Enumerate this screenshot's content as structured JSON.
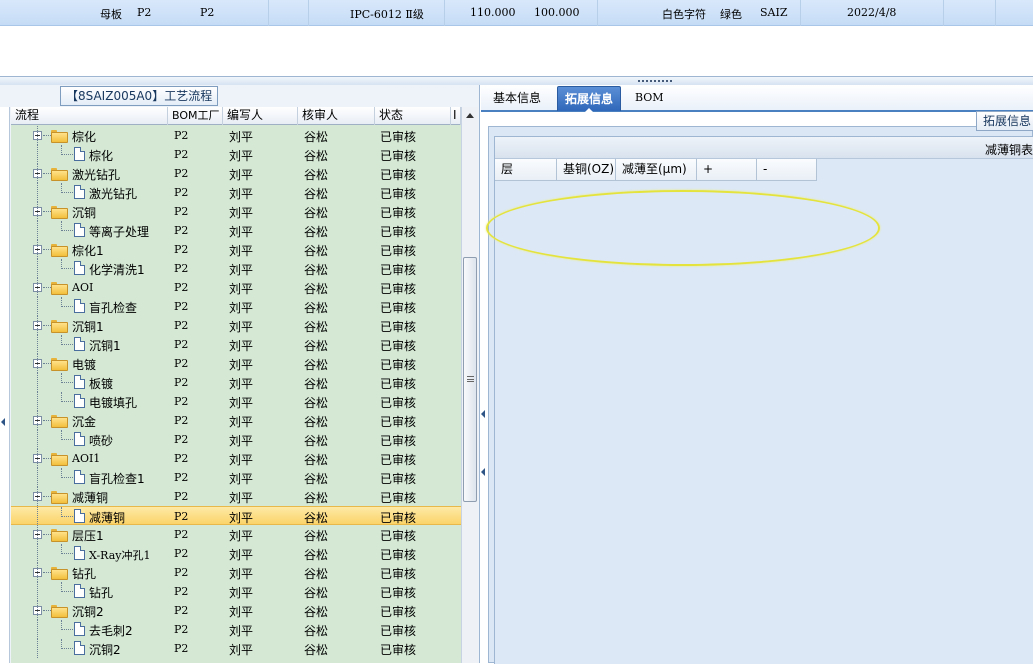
{
  "top_row": {
    "cells": [
      "母板",
      "P2",
      "P2",
      "IPC-6012 Ⅱ级",
      "110.000",
      "100.000",
      "白色字符",
      "绿色",
      "SAIZ",
      "2022/4/8"
    ]
  },
  "left_panel": {
    "caption": "【8SAIZ005A0】工艺流程",
    "columns": [
      "流程",
      "BOM工厂",
      "编写人",
      "核审人",
      "状态",
      "I"
    ],
    "rows": [
      {
        "name": "棕化",
        "level": 0,
        "bom": "P2",
        "writer": "刘平",
        "reviewer": "谷松",
        "status": "已审核"
      },
      {
        "name": "棕化",
        "level": 1,
        "bom": "P2",
        "writer": "刘平",
        "reviewer": "谷松",
        "status": "已审核"
      },
      {
        "name": "激光钻孔",
        "level": 0,
        "bom": "P2",
        "writer": "刘平",
        "reviewer": "谷松",
        "status": "已审核"
      },
      {
        "name": "激光钻孔",
        "level": 1,
        "bom": "P2",
        "writer": "刘平",
        "reviewer": "谷松",
        "status": "已审核"
      },
      {
        "name": "沉铜",
        "level": 0,
        "bom": "P2",
        "writer": "刘平",
        "reviewer": "谷松",
        "status": "已审核"
      },
      {
        "name": "等离子处理",
        "level": 1,
        "bom": "P2",
        "writer": "刘平",
        "reviewer": "谷松",
        "status": "已审核"
      },
      {
        "name": "棕化1",
        "level": 0,
        "bom": "P2",
        "writer": "刘平",
        "reviewer": "谷松",
        "status": "已审核"
      },
      {
        "name": "化学清洗1",
        "level": 1,
        "bom": "P2",
        "writer": "刘平",
        "reviewer": "谷松",
        "status": "已审核"
      },
      {
        "name": "AOI",
        "level": 0,
        "bom": "P2",
        "writer": "刘平",
        "reviewer": "谷松",
        "status": "已审核"
      },
      {
        "name": "盲孔检查",
        "level": 1,
        "bom": "P2",
        "writer": "刘平",
        "reviewer": "谷松",
        "status": "已审核"
      },
      {
        "name": "沉铜1",
        "level": 0,
        "bom": "P2",
        "writer": "刘平",
        "reviewer": "谷松",
        "status": "已审核"
      },
      {
        "name": "沉铜1",
        "level": 1,
        "bom": "P2",
        "writer": "刘平",
        "reviewer": "谷松",
        "status": "已审核"
      },
      {
        "name": "电镀",
        "level": 0,
        "bom": "P2",
        "writer": "刘平",
        "reviewer": "谷松",
        "status": "已审核"
      },
      {
        "name": "板镀",
        "level": 1,
        "bom": "P2",
        "writer": "刘平",
        "reviewer": "谷松",
        "status": "已审核"
      },
      {
        "name": "电镀填孔",
        "level": 1,
        "bom": "P2",
        "writer": "刘平",
        "reviewer": "谷松",
        "status": "已审核"
      },
      {
        "name": "沉金",
        "level": 0,
        "bom": "P2",
        "writer": "刘平",
        "reviewer": "谷松",
        "status": "已审核"
      },
      {
        "name": "喷砂",
        "level": 1,
        "bom": "P2",
        "writer": "刘平",
        "reviewer": "谷松",
        "status": "已审核"
      },
      {
        "name": "AOI1",
        "level": 0,
        "bom": "P2",
        "writer": "刘平",
        "reviewer": "谷松",
        "status": "已审核"
      },
      {
        "name": "盲孔检查1",
        "level": 1,
        "bom": "P2",
        "writer": "刘平",
        "reviewer": "谷松",
        "status": "已审核"
      },
      {
        "name": "减薄铜",
        "level": 0,
        "bom": "P2",
        "writer": "刘平",
        "reviewer": "谷松",
        "status": "已审核"
      },
      {
        "name": "减薄铜",
        "level": 1,
        "bom": "P2",
        "writer": "刘平",
        "reviewer": "谷松",
        "status": "已审核",
        "selected": true
      },
      {
        "name": "层压1",
        "level": 0,
        "bom": "P2",
        "writer": "刘平",
        "reviewer": "谷松",
        "status": "已审核"
      },
      {
        "name": "X-Ray冲孔1",
        "level": 1,
        "bom": "P2",
        "writer": "刘平",
        "reviewer": "谷松",
        "status": "已审核"
      },
      {
        "name": "钻孔",
        "level": 0,
        "bom": "P2",
        "writer": "刘平",
        "reviewer": "谷松",
        "status": "已审核"
      },
      {
        "name": "钻孔",
        "level": 1,
        "bom": "P2",
        "writer": "刘平",
        "reviewer": "谷松",
        "status": "已审核"
      },
      {
        "name": "沉铜2",
        "level": 0,
        "bom": "P2",
        "writer": "刘平",
        "reviewer": "谷松",
        "status": "已审核"
      },
      {
        "name": "去毛刺2",
        "level": 1,
        "bom": "P2",
        "writer": "刘平",
        "reviewer": "谷松",
        "status": "已审核"
      },
      {
        "name": "沉铜2",
        "level": 1,
        "bom": "P2",
        "writer": "刘平",
        "reviewer": "谷松",
        "status": "已审核"
      }
    ]
  },
  "right_panel": {
    "tabs": [
      {
        "label": "基本信息",
        "active": false
      },
      {
        "label": "拓展信息",
        "active": true
      },
      {
        "label": "BOM",
        "active": false
      }
    ],
    "ext_button": "拓展信息",
    "table_title": "减薄铜表",
    "table_columns": [
      "层",
      "基铜(OZ)",
      "减薄至(μm)",
      "+",
      "-"
    ]
  },
  "colors": {
    "grid_bg": "#d4e8d4",
    "selected_row": "#fbd46a",
    "active_tab": "#2f67b9",
    "annotation_ellipse": "#e4e33e"
  },
  "icons": {
    "tree_group": "folder-icon",
    "tree_leaf": "document-icon",
    "tree_toggle": "collapse-icon"
  }
}
